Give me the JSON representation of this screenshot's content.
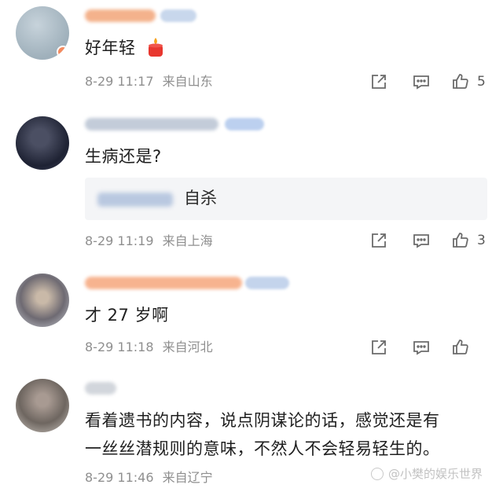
{
  "comments": [
    {
      "content": "好年轻",
      "emoji": "candle-emoji",
      "time": "8-29 11:17",
      "location": "来自山东",
      "likes": "5"
    },
    {
      "content": "生病还是?",
      "reply_preview": "自杀",
      "time": "8-29 11:19",
      "location": "来自上海",
      "likes": "3"
    },
    {
      "content": "才 27 岁啊",
      "time": "8-29 11:18",
      "location": "来自河北",
      "likes": ""
    },
    {
      "content_line1": "看着遗书的内容，说点阴谋论的话，感觉还是有",
      "content_line2": "一丝丝潜规则的意味，不然人不会轻易轻生的。",
      "time": "8-29 11:46",
      "location": "来自辽宁"
    }
  ],
  "watermark": "@小樊的娱乐世界",
  "colors": {
    "meta_text": "#8f8f8f",
    "icon": "#6b6b6b",
    "username_orange": "#f6b08a",
    "username_blue": "#c9d8ee"
  }
}
